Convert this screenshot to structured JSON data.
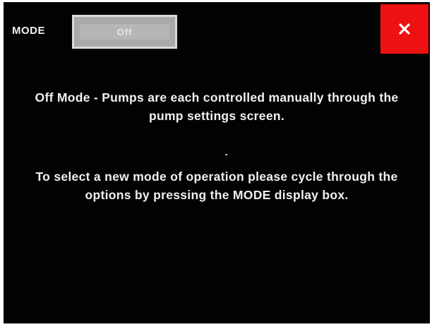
{
  "header": {
    "mode_label": "MODE",
    "mode_value": "Off"
  },
  "close_button": {
    "label": "×",
    "icon": "close-icon",
    "color": "#ee1111"
  },
  "messages": {
    "description": "Off Mode - Pumps are each controlled manually through the pump settings screen.",
    "instruction": "To select a new mode of operation please cycle through the options by pressing the MODE display box."
  },
  "colors": {
    "background": "#020202",
    "text": "#f0f0f0",
    "mode_box": "#a9a9a9",
    "close": "#ee1111"
  }
}
